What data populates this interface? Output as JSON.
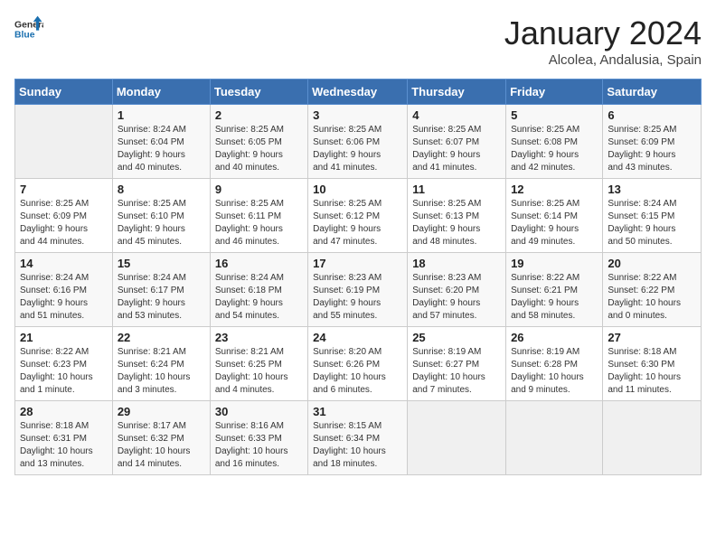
{
  "header": {
    "logo_general": "General",
    "logo_blue": "Blue",
    "month_title": "January 2024",
    "subtitle": "Alcolea, Andalusia, Spain"
  },
  "columns": [
    "Sunday",
    "Monday",
    "Tuesday",
    "Wednesday",
    "Thursday",
    "Friday",
    "Saturday"
  ],
  "weeks": [
    [
      {
        "day": "",
        "info": ""
      },
      {
        "day": "1",
        "info": "Sunrise: 8:24 AM\nSunset: 6:04 PM\nDaylight: 9 hours\nand 40 minutes."
      },
      {
        "day": "2",
        "info": "Sunrise: 8:25 AM\nSunset: 6:05 PM\nDaylight: 9 hours\nand 40 minutes."
      },
      {
        "day": "3",
        "info": "Sunrise: 8:25 AM\nSunset: 6:06 PM\nDaylight: 9 hours\nand 41 minutes."
      },
      {
        "day": "4",
        "info": "Sunrise: 8:25 AM\nSunset: 6:07 PM\nDaylight: 9 hours\nand 41 minutes."
      },
      {
        "day": "5",
        "info": "Sunrise: 8:25 AM\nSunset: 6:08 PM\nDaylight: 9 hours\nand 42 minutes."
      },
      {
        "day": "6",
        "info": "Sunrise: 8:25 AM\nSunset: 6:09 PM\nDaylight: 9 hours\nand 43 minutes."
      }
    ],
    [
      {
        "day": "7",
        "info": "Sunrise: 8:25 AM\nSunset: 6:09 PM\nDaylight: 9 hours\nand 44 minutes."
      },
      {
        "day": "8",
        "info": "Sunrise: 8:25 AM\nSunset: 6:10 PM\nDaylight: 9 hours\nand 45 minutes."
      },
      {
        "day": "9",
        "info": "Sunrise: 8:25 AM\nSunset: 6:11 PM\nDaylight: 9 hours\nand 46 minutes."
      },
      {
        "day": "10",
        "info": "Sunrise: 8:25 AM\nSunset: 6:12 PM\nDaylight: 9 hours\nand 47 minutes."
      },
      {
        "day": "11",
        "info": "Sunrise: 8:25 AM\nSunset: 6:13 PM\nDaylight: 9 hours\nand 48 minutes."
      },
      {
        "day": "12",
        "info": "Sunrise: 8:25 AM\nSunset: 6:14 PM\nDaylight: 9 hours\nand 49 minutes."
      },
      {
        "day": "13",
        "info": "Sunrise: 8:24 AM\nSunset: 6:15 PM\nDaylight: 9 hours\nand 50 minutes."
      }
    ],
    [
      {
        "day": "14",
        "info": "Sunrise: 8:24 AM\nSunset: 6:16 PM\nDaylight: 9 hours\nand 51 minutes."
      },
      {
        "day": "15",
        "info": "Sunrise: 8:24 AM\nSunset: 6:17 PM\nDaylight: 9 hours\nand 53 minutes."
      },
      {
        "day": "16",
        "info": "Sunrise: 8:24 AM\nSunset: 6:18 PM\nDaylight: 9 hours\nand 54 minutes."
      },
      {
        "day": "17",
        "info": "Sunrise: 8:23 AM\nSunset: 6:19 PM\nDaylight: 9 hours\nand 55 minutes."
      },
      {
        "day": "18",
        "info": "Sunrise: 8:23 AM\nSunset: 6:20 PM\nDaylight: 9 hours\nand 57 minutes."
      },
      {
        "day": "19",
        "info": "Sunrise: 8:22 AM\nSunset: 6:21 PM\nDaylight: 9 hours\nand 58 minutes."
      },
      {
        "day": "20",
        "info": "Sunrise: 8:22 AM\nSunset: 6:22 PM\nDaylight: 10 hours\nand 0 minutes."
      }
    ],
    [
      {
        "day": "21",
        "info": "Sunrise: 8:22 AM\nSunset: 6:23 PM\nDaylight: 10 hours\nand 1 minute."
      },
      {
        "day": "22",
        "info": "Sunrise: 8:21 AM\nSunset: 6:24 PM\nDaylight: 10 hours\nand 3 minutes."
      },
      {
        "day": "23",
        "info": "Sunrise: 8:21 AM\nSunset: 6:25 PM\nDaylight: 10 hours\nand 4 minutes."
      },
      {
        "day": "24",
        "info": "Sunrise: 8:20 AM\nSunset: 6:26 PM\nDaylight: 10 hours\nand 6 minutes."
      },
      {
        "day": "25",
        "info": "Sunrise: 8:19 AM\nSunset: 6:27 PM\nDaylight: 10 hours\nand 7 minutes."
      },
      {
        "day": "26",
        "info": "Sunrise: 8:19 AM\nSunset: 6:28 PM\nDaylight: 10 hours\nand 9 minutes."
      },
      {
        "day": "27",
        "info": "Sunrise: 8:18 AM\nSunset: 6:30 PM\nDaylight: 10 hours\nand 11 minutes."
      }
    ],
    [
      {
        "day": "28",
        "info": "Sunrise: 8:18 AM\nSunset: 6:31 PM\nDaylight: 10 hours\nand 13 minutes."
      },
      {
        "day": "29",
        "info": "Sunrise: 8:17 AM\nSunset: 6:32 PM\nDaylight: 10 hours\nand 14 minutes."
      },
      {
        "day": "30",
        "info": "Sunrise: 8:16 AM\nSunset: 6:33 PM\nDaylight: 10 hours\nand 16 minutes."
      },
      {
        "day": "31",
        "info": "Sunrise: 8:15 AM\nSunset: 6:34 PM\nDaylight: 10 hours\nand 18 minutes."
      },
      {
        "day": "",
        "info": ""
      },
      {
        "day": "",
        "info": ""
      },
      {
        "day": "",
        "info": ""
      }
    ]
  ]
}
